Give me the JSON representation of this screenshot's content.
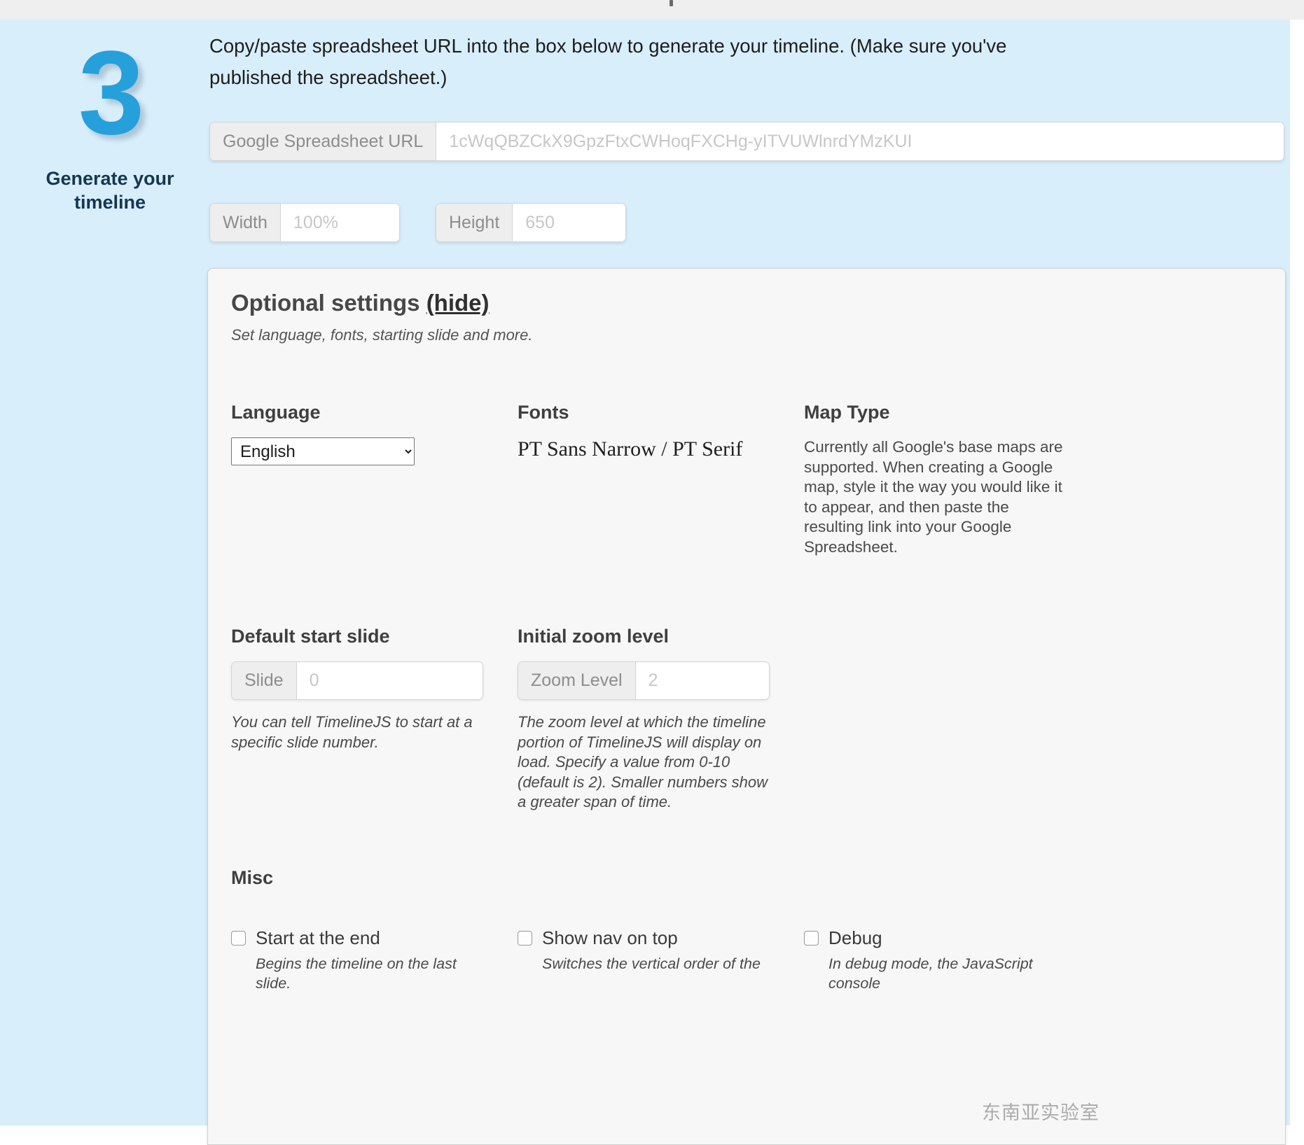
{
  "step": {
    "number": "3",
    "caption_line1": "Generate your",
    "caption_line2": "timeline",
    "accent_color": "#26a0da",
    "caption_color": "#15374f"
  },
  "intro": {
    "text": "Copy/paste spreadsheet URL into the box below to generate your timeline. (Make sure you've published the spreadsheet.)"
  },
  "form": {
    "sheet_url": {
      "addon_label": "Google Spreadsheet URL",
      "value": "",
      "placeholder": "1cWqQBZCkX9GpzFtxCWHoqFXCHg-yITVUWlnrdYMzKUI"
    },
    "width": {
      "addon_label": "Width",
      "value": "",
      "placeholder": "100%"
    },
    "height": {
      "addon_label": "Height",
      "value": "",
      "placeholder": "650"
    }
  },
  "optional_settings": {
    "title": "Optional settings",
    "toggle_label": "(hide)",
    "subtitle": "Set language, fonts, starting slide and more.",
    "language": {
      "heading": "Language",
      "selected": "English",
      "options": [
        "English"
      ]
    },
    "fonts": {
      "heading": "Fonts",
      "value": "PT Sans Narrow / PT Serif"
    },
    "map_type": {
      "heading": "Map Type",
      "body": "Currently all Google's base maps are supported. When creating a Google map, style it the way you would like it to appear, and then paste the resulting link into your Google Spreadsheet."
    },
    "default_start_slide": {
      "heading": "Default start slide",
      "addon_label": "Slide",
      "value": "",
      "placeholder": "0",
      "note": "You can tell TimelineJS to start at a specific slide number."
    },
    "initial_zoom_level": {
      "heading": "Initial zoom level",
      "addon_label": "Zoom Level",
      "value": "",
      "placeholder": "2",
      "note": "The zoom level at which the timeline portion of TimelineJS will display on load. Specify a value from 0-10 (default is 2). Smaller numbers show a greater span of time."
    },
    "misc": {
      "heading": "Misc",
      "checkboxes": [
        {
          "label": "Start at the end",
          "note": "Begins the timeline on the last slide.",
          "checked": false
        },
        {
          "label": "Show nav on top",
          "note": "Switches the vertical order of the",
          "checked": false
        },
        {
          "label": "Debug",
          "note": "In debug mode, the JavaScript console",
          "checked": false
        }
      ]
    }
  },
  "watermark": {
    "text": "东南亚实验室"
  }
}
